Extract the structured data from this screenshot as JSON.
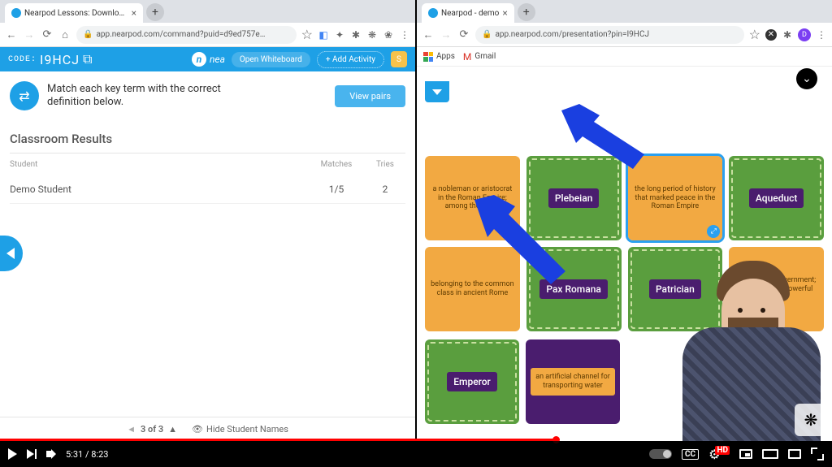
{
  "left": {
    "tab_title": "Nearpod Lessons: Download r",
    "url": "app.nearpod.com/command?puid=d9ed757e…",
    "header": {
      "code_label": "CODE:",
      "code": "I9HCJ",
      "brand": "nea",
      "whiteboard_btn": "Open Whiteboard",
      "add_activity_btn": "+ Add Activity",
      "end_badge": "S"
    },
    "instruction": "Match each key term with the correct definition below.",
    "view_pairs_btn": "View pairs",
    "results": {
      "title": "Classroom Results",
      "cols": {
        "student": "Student",
        "matches": "Matches",
        "tries": "Tries"
      },
      "rows": [
        {
          "student": "Demo Student",
          "matches": "1/5",
          "tries": "2"
        }
      ]
    },
    "footer": {
      "pager": "3 of 3",
      "hide_names": "Hide Student Names"
    }
  },
  "right": {
    "tab_title": "Nearpod - demo",
    "url": "app.nearpod.com/presentation?pin=I9HCJ",
    "bookmarks": {
      "apps": "Apps",
      "gmail": "Gmail"
    },
    "cards": {
      "def_nobleman": "a nobleman or aristocrat in the Roman Empire; among the ruling",
      "term_plebeian": "Plebeian",
      "def_pax": "the long period of history that marked peace in the Roman Empire",
      "term_aqueduct": "Aqueduct",
      "def_common": "belonging to the common class in ancient Rome",
      "term_pax": "Pax Romana",
      "term_patrician": "Patrician",
      "def_head": "the head of government; usually an all-powerful leader",
      "term_emperor": "Emperor",
      "def_channel": "an artificial channel for transporting water"
    }
  },
  "player": {
    "current": "5:31",
    "total": "8:23",
    "cc": "CC",
    "hd": "HD"
  }
}
